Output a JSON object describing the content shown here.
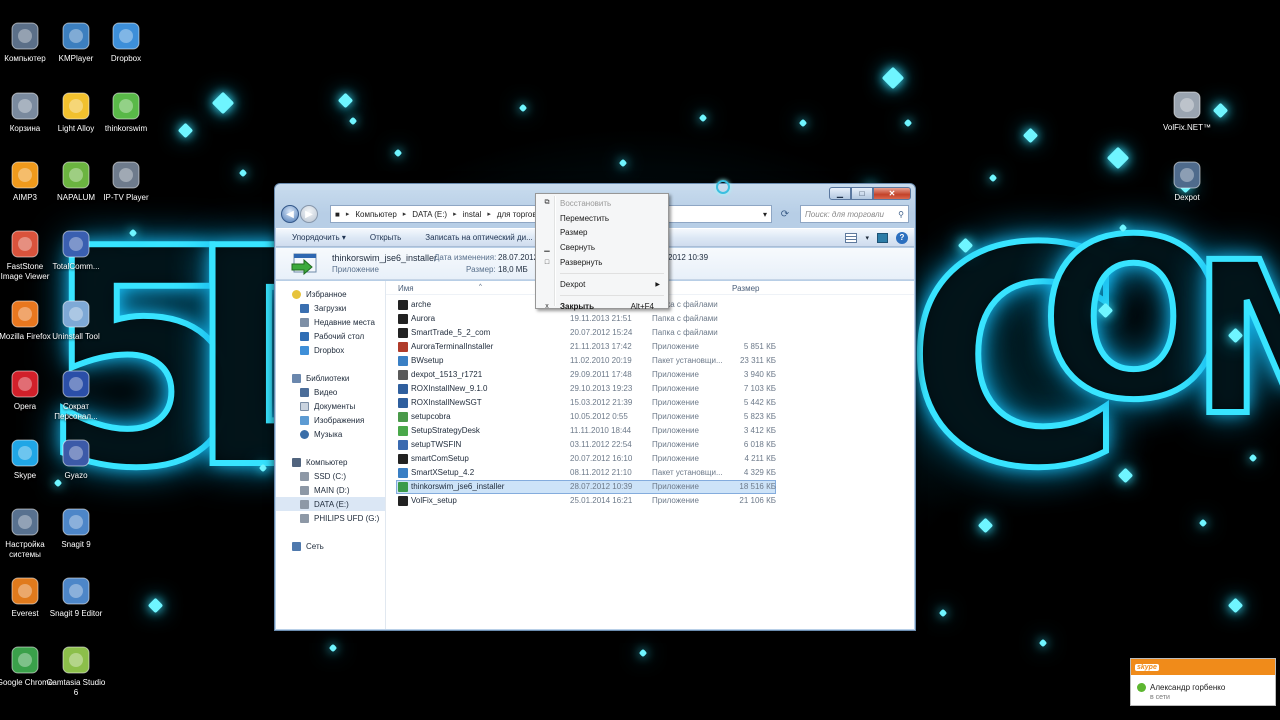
{
  "desktop": {
    "icons_left": [
      {
        "label": "Компьютер",
        "icon": "computer-icon"
      },
      {
        "label": "KMPlayer",
        "icon": "kmplayer-icon"
      },
      {
        "label": "Dropbox",
        "icon": "dropbox-icon"
      },
      {
        "label": "Корзина",
        "icon": "recycle-bin-icon"
      },
      {
        "label": "Light Alloy",
        "icon": "light-alloy-icon"
      },
      {
        "label": "thinkorswim",
        "icon": "thinkorswim-icon"
      },
      {
        "label": "AIMP3",
        "icon": "aimp-icon"
      },
      {
        "label": "NAPALUM",
        "icon": "napalum-icon"
      },
      {
        "label": "IP-TV Player",
        "icon": "iptv-icon"
      },
      {
        "label": "FastStone Image Viewer",
        "icon": "faststone-icon"
      },
      {
        "label": "TotalComm...",
        "icon": "floppy-icon"
      },
      {
        "label": "Mozilla Firefox",
        "icon": "firefox-icon"
      },
      {
        "label": "Uninstall Tool",
        "icon": "uninstall-icon"
      },
      {
        "label": "Opera",
        "icon": "opera-icon"
      },
      {
        "label": "Сократ Персонал...",
        "icon": "socrat-icon"
      },
      {
        "label": "Skype",
        "icon": "skype-icon"
      },
      {
        "label": "Gyazo",
        "icon": "gyazo-icon"
      },
      {
        "label": "Настройка системы",
        "icon": "settings-icon"
      },
      {
        "label": "Snagit 9",
        "icon": "snagit-icon"
      },
      {
        "label": "Everest",
        "icon": "everest-icon"
      },
      {
        "label": "Snagit 9 Editor",
        "icon": "snagit-editor-icon"
      },
      {
        "label": "Google Chrome",
        "icon": "chrome-icon"
      },
      {
        "label": "Camtasia Studio 6",
        "icon": "camtasia-icon"
      }
    ],
    "icons_right": [
      {
        "label": "VolFix.NET™",
        "icon": "volfix-icon"
      },
      {
        "label": "Dexpot",
        "icon": "dexpot-icon"
      }
    ],
    "wallpaper_text": "5D .COM"
  },
  "explorer": {
    "breadcrumb": [
      "Компьютер",
      "DATA (E:)",
      "instal",
      "для торгов..."
    ],
    "search_placeholder": "Поиск: для торговли",
    "toolbar": {
      "organize": "Упорядочить ▾",
      "open": "Открыть",
      "burn": "Записать на оптический ди..."
    },
    "details": {
      "name": "thinkorswim_jse6_installer",
      "type": "Приложение",
      "modified_label": "Дата изменения:",
      "modified_value": "28.07.2012",
      "modified_tail": "2012 10:39",
      "size_label": "Размер:",
      "size_value": "18,0 МБ"
    },
    "nav_pane": {
      "favorites": {
        "label": "Избранное",
        "items": [
          "Загрузки",
          "Недавние места",
          "Рабочий стол",
          "Dropbox"
        ]
      },
      "libraries": {
        "label": "Библиотеки",
        "items": [
          "Видео",
          "Документы",
          "Изображения",
          "Музыка"
        ]
      },
      "computer": {
        "label": "Компьютер",
        "items": [
          "SSD (C:)",
          "MAIN (D:)",
          "DATA (E:)",
          "PHILIPS UFD (G:)"
        ]
      },
      "network": {
        "label": "Сеть"
      }
    },
    "columns": {
      "name": "Имя",
      "size": "Размер"
    },
    "files": [
      {
        "name": "arche",
        "date": "",
        "type": "Папка с файлами",
        "size": "",
        "color": "#222222"
      },
      {
        "name": "Aurora",
        "date": "19.11.2013 21:51",
        "type": "Папка с файлами",
        "size": "",
        "color": "#222222"
      },
      {
        "name": "SmartTrade_5_2_com",
        "date": "20.07.2012 15:24",
        "type": "Папка с файлами",
        "size": "",
        "color": "#222222"
      },
      {
        "name": "AuroraTerminalInstaller",
        "date": "21.11.2013 17:42",
        "type": "Приложение",
        "size": "5 851 КБ",
        "color": "#b03b2a"
      },
      {
        "name": "BWsetup",
        "date": "11.02.2010 20:19",
        "type": "Пакет установщи...",
        "size": "23 311 КБ",
        "color": "#3a7fc4"
      },
      {
        "name": "dexpot_1513_r1721",
        "date": "29.09.2011 17:48",
        "type": "Приложение",
        "size": "3 940 КБ",
        "color": "#5a5a5a"
      },
      {
        "name": "ROXInstallNew_9.1.0",
        "date": "29.10.2013 19:23",
        "type": "Приложение",
        "size": "7 103 КБ",
        "color": "#2f5f9e"
      },
      {
        "name": "ROXInstallNewSGT",
        "date": "15.03.2012 21:39",
        "type": "Приложение",
        "size": "5 442 КБ",
        "color": "#2f5f9e"
      },
      {
        "name": "setupcobra",
        "date": "10.05.2012 0:55",
        "type": "Приложение",
        "size": "5 823 КБ",
        "color": "#4a9a4a"
      },
      {
        "name": "SetupStrategyDesk",
        "date": "11.11.2010 18:44",
        "type": "Приложение",
        "size": "3 412 КБ",
        "color": "#4aa84a"
      },
      {
        "name": "setupTWSFIN",
        "date": "03.11.2012 22:54",
        "type": "Приложение",
        "size": "6 018 КБ",
        "color": "#3a6ab0"
      },
      {
        "name": "smartComSetup",
        "date": "20.07.2012 16:10",
        "type": "Приложение",
        "size": "4 211 КБ",
        "color": "#222222"
      },
      {
        "name": "SmartXSetup_4.2",
        "date": "08.11.2012 21:10",
        "type": "Пакет установщи...",
        "size": "4 329 КБ",
        "color": "#3a7fc4"
      },
      {
        "name": "thinkorswim_jse6_installer",
        "date": "28.07.2012 10:39",
        "type": "Приложение",
        "size": "18 516 КБ",
        "color": "#3a9a4a"
      },
      {
        "name": "VolFix_setup",
        "date": "25.01.2014 16:21",
        "type": "Приложение",
        "size": "21 106 КБ",
        "color": "#222222"
      }
    ],
    "selected_file": "thinkorswim_jse6_installer"
  },
  "context_menu": {
    "items": [
      {
        "label": "Восстановить",
        "glyph": "⧉",
        "disabled": true
      },
      {
        "label": "Переместить",
        "glyph": "",
        "disabled": false
      },
      {
        "label": "Размер",
        "glyph": "",
        "disabled": false
      },
      {
        "label": "Свернуть",
        "glyph": "▁",
        "disabled": false
      },
      {
        "label": "Развернуть",
        "glyph": "□",
        "disabled": false
      }
    ],
    "dexpot": "Dexpot",
    "close": {
      "label": "Закрыть",
      "shortcut": "Alt+F4",
      "glyph": "x"
    }
  },
  "skype_popup": {
    "logo": "skype",
    "name": "Александр горбенко",
    "status": "в сети"
  }
}
